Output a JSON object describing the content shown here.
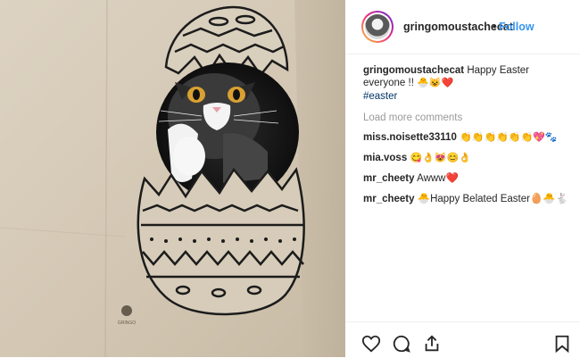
{
  "post": {
    "username": "gringomoustachecat",
    "separator": "•",
    "follow_label": "Follow"
  },
  "caption": {
    "username": "gringomoustachecat",
    "text": "Happy Easter everyone !!",
    "emojis": "🐣😺❤️",
    "hashtag": "#easter"
  },
  "load_more_label": "Load more comments",
  "comments": [
    {
      "username": "miss.noisette33110",
      "text": "👏👏👏👏👏👏💖🐾"
    },
    {
      "username": "mia.voss",
      "text": "😋👌😻😊👌"
    },
    {
      "username": "mr_cheety",
      "text": "Awww❤️"
    },
    {
      "username": "mr_cheety",
      "text": "🐣Happy Belated Easter🥚🐣🐇"
    }
  ],
  "photo": {
    "watermark": "GRINGO",
    "colors": {
      "cardboard": "#d4c9b6",
      "ink": "#1c1c1c",
      "eye": "#d9a032"
    }
  },
  "icons": [
    "heart-icon",
    "comment-icon",
    "share-icon",
    "bookmark-icon"
  ]
}
